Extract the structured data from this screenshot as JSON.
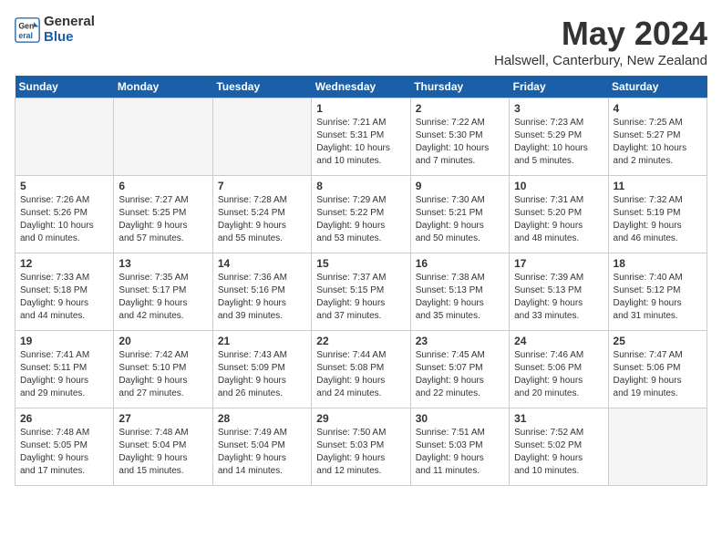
{
  "logo": {
    "general": "General",
    "blue": "Blue"
  },
  "title": "May 2024",
  "location": "Halswell, Canterbury, New Zealand",
  "headers": [
    "Sunday",
    "Monday",
    "Tuesday",
    "Wednesday",
    "Thursday",
    "Friday",
    "Saturday"
  ],
  "weeks": [
    [
      {
        "day": "",
        "info": "",
        "empty": true
      },
      {
        "day": "",
        "info": "",
        "empty": true
      },
      {
        "day": "",
        "info": "",
        "empty": true
      },
      {
        "day": "1",
        "info": "Sunrise: 7:21 AM\nSunset: 5:31 PM\nDaylight: 10 hours\nand 10 minutes."
      },
      {
        "day": "2",
        "info": "Sunrise: 7:22 AM\nSunset: 5:30 PM\nDaylight: 10 hours\nand 7 minutes."
      },
      {
        "day": "3",
        "info": "Sunrise: 7:23 AM\nSunset: 5:29 PM\nDaylight: 10 hours\nand 5 minutes."
      },
      {
        "day": "4",
        "info": "Sunrise: 7:25 AM\nSunset: 5:27 PM\nDaylight: 10 hours\nand 2 minutes."
      }
    ],
    [
      {
        "day": "5",
        "info": "Sunrise: 7:26 AM\nSunset: 5:26 PM\nDaylight: 10 hours\nand 0 minutes."
      },
      {
        "day": "6",
        "info": "Sunrise: 7:27 AM\nSunset: 5:25 PM\nDaylight: 9 hours\nand 57 minutes."
      },
      {
        "day": "7",
        "info": "Sunrise: 7:28 AM\nSunset: 5:24 PM\nDaylight: 9 hours\nand 55 minutes."
      },
      {
        "day": "8",
        "info": "Sunrise: 7:29 AM\nSunset: 5:22 PM\nDaylight: 9 hours\nand 53 minutes."
      },
      {
        "day": "9",
        "info": "Sunrise: 7:30 AM\nSunset: 5:21 PM\nDaylight: 9 hours\nand 50 minutes."
      },
      {
        "day": "10",
        "info": "Sunrise: 7:31 AM\nSunset: 5:20 PM\nDaylight: 9 hours\nand 48 minutes."
      },
      {
        "day": "11",
        "info": "Sunrise: 7:32 AM\nSunset: 5:19 PM\nDaylight: 9 hours\nand 46 minutes."
      }
    ],
    [
      {
        "day": "12",
        "info": "Sunrise: 7:33 AM\nSunset: 5:18 PM\nDaylight: 9 hours\nand 44 minutes."
      },
      {
        "day": "13",
        "info": "Sunrise: 7:35 AM\nSunset: 5:17 PM\nDaylight: 9 hours\nand 42 minutes."
      },
      {
        "day": "14",
        "info": "Sunrise: 7:36 AM\nSunset: 5:16 PM\nDaylight: 9 hours\nand 39 minutes."
      },
      {
        "day": "15",
        "info": "Sunrise: 7:37 AM\nSunset: 5:15 PM\nDaylight: 9 hours\nand 37 minutes."
      },
      {
        "day": "16",
        "info": "Sunrise: 7:38 AM\nSunset: 5:13 PM\nDaylight: 9 hours\nand 35 minutes."
      },
      {
        "day": "17",
        "info": "Sunrise: 7:39 AM\nSunset: 5:13 PM\nDaylight: 9 hours\nand 33 minutes."
      },
      {
        "day": "18",
        "info": "Sunrise: 7:40 AM\nSunset: 5:12 PM\nDaylight: 9 hours\nand 31 minutes."
      }
    ],
    [
      {
        "day": "19",
        "info": "Sunrise: 7:41 AM\nSunset: 5:11 PM\nDaylight: 9 hours\nand 29 minutes."
      },
      {
        "day": "20",
        "info": "Sunrise: 7:42 AM\nSunset: 5:10 PM\nDaylight: 9 hours\nand 27 minutes."
      },
      {
        "day": "21",
        "info": "Sunrise: 7:43 AM\nSunset: 5:09 PM\nDaylight: 9 hours\nand 26 minutes."
      },
      {
        "day": "22",
        "info": "Sunrise: 7:44 AM\nSunset: 5:08 PM\nDaylight: 9 hours\nand 24 minutes."
      },
      {
        "day": "23",
        "info": "Sunrise: 7:45 AM\nSunset: 5:07 PM\nDaylight: 9 hours\nand 22 minutes."
      },
      {
        "day": "24",
        "info": "Sunrise: 7:46 AM\nSunset: 5:06 PM\nDaylight: 9 hours\nand 20 minutes."
      },
      {
        "day": "25",
        "info": "Sunrise: 7:47 AM\nSunset: 5:06 PM\nDaylight: 9 hours\nand 19 minutes."
      }
    ],
    [
      {
        "day": "26",
        "info": "Sunrise: 7:48 AM\nSunset: 5:05 PM\nDaylight: 9 hours\nand 17 minutes."
      },
      {
        "day": "27",
        "info": "Sunrise: 7:48 AM\nSunset: 5:04 PM\nDaylight: 9 hours\nand 15 minutes."
      },
      {
        "day": "28",
        "info": "Sunrise: 7:49 AM\nSunset: 5:04 PM\nDaylight: 9 hours\nand 14 minutes."
      },
      {
        "day": "29",
        "info": "Sunrise: 7:50 AM\nSunset: 5:03 PM\nDaylight: 9 hours\nand 12 minutes."
      },
      {
        "day": "30",
        "info": "Sunrise: 7:51 AM\nSunset: 5:03 PM\nDaylight: 9 hours\nand 11 minutes."
      },
      {
        "day": "31",
        "info": "Sunrise: 7:52 AM\nSunset: 5:02 PM\nDaylight: 9 hours\nand 10 minutes."
      },
      {
        "day": "",
        "info": "",
        "empty": true
      }
    ]
  ]
}
